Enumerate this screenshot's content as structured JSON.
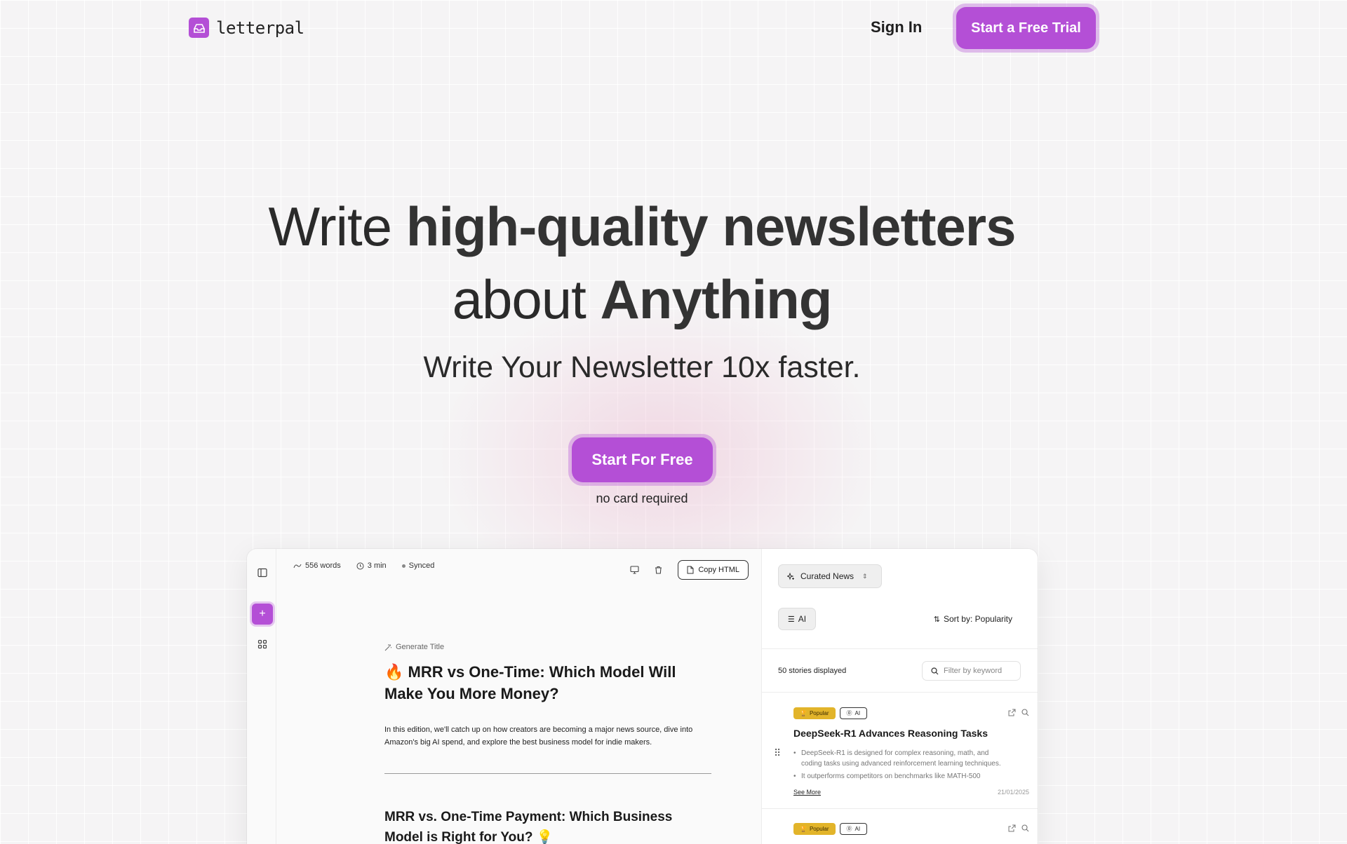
{
  "brand": {
    "name": "letterpal",
    "accent": "#b44fd6"
  },
  "nav": {
    "sign_in": "Sign In",
    "trial": "Start a Free Trial"
  },
  "hero": {
    "line1_a": "Write ",
    "line1_b": "high-quality newsletters",
    "line2_a": "about ",
    "line2_b": "Anything",
    "subhead": "Write Your Newsletter 10x faster.",
    "cta": "Start For Free",
    "cta_note": "no card required"
  },
  "editor": {
    "word_count": "556 words",
    "read_time": "3 min",
    "sync_status": "Synced",
    "copy_html": "Copy HTML",
    "generate_title": "Generate Title",
    "post_title": "🔥 MRR vs One-Time: Which Model Will Make You More Money?",
    "post_intro": "In this edition, we'll catch up on how creators are becoming a major news source, dive into Amazon's big AI spend, and explore the best business model for indie makers.",
    "section_title": "MRR vs. One-Time Payment: Which Business Model is Right for You? 💡"
  },
  "panel": {
    "source": "Curated News",
    "topic_filter": "AI",
    "sort": "Sort by: Popularity",
    "stories_count": "50 stories displayed",
    "filter_placeholder": "Filter by keyword",
    "stories": [
      {
        "badge_popular": "Popular",
        "badge_topic": "AI",
        "title": "DeepSeek-R1 Advances Reasoning Tasks",
        "bullets": [
          "DeepSeek-R1 is designed for complex reasoning, math, and coding tasks using advanced reinforcement learning techniques.",
          "It outperforms competitors on benchmarks like MATH-500"
        ],
        "see_more": "See More",
        "date": "21/01/2025"
      },
      {
        "badge_popular": "Popular",
        "badge_topic": "AI"
      }
    ]
  }
}
